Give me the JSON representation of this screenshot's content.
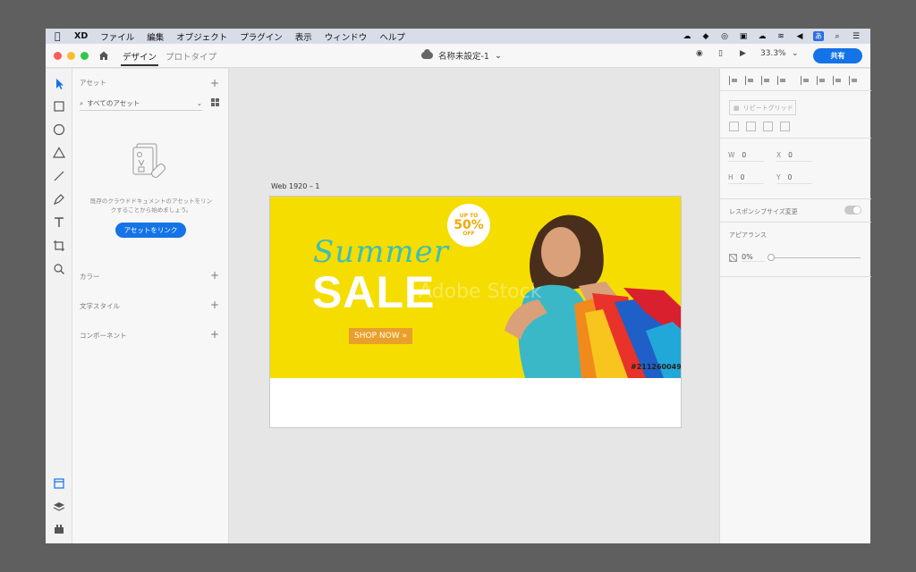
{
  "menubar": {
    "app": "XD",
    "items": [
      "ファイル",
      "編集",
      "オブジェクト",
      "プラグイン",
      "表示",
      "ウィンドウ",
      "ヘルプ"
    ],
    "ime": "あ"
  },
  "titlebar": {
    "tabs": [
      "デザイン",
      "プロトタイプ"
    ],
    "doc_title": "名称未設定-1",
    "zoom": "33.3%",
    "share": "共有"
  },
  "assets": {
    "title": "アセット",
    "filter": "すべてのアセット",
    "empty_text": "既存のクラウドドキュメントのアセットをリンクすることから始めましょう。",
    "link_button": "アセットをリンク",
    "sections": [
      "カラー",
      "文字スタイル",
      "コンポーネント"
    ]
  },
  "canvas": {
    "artboard_name": "Web 1920 – 1",
    "banner": {
      "badge_top": "UP TO",
      "badge_pct": "50%",
      "badge_bottom": "OFF",
      "summer": "Summer",
      "sale": "SALE",
      "shop_now": "SHOP NOW »",
      "watermark": "Adobe Stock",
      "stock_id": "#211260049"
    }
  },
  "properties": {
    "repeat_grid": "リピートグリッド",
    "w_label": "W",
    "w": "0",
    "h_label": "H",
    "h": "0",
    "x_label": "X",
    "x": "0",
    "y_label": "Y",
    "y": "0",
    "responsive_resize": "レスポンシブサイズ変更",
    "appearance": "アピアランス",
    "opacity": "0%"
  },
  "colors": {
    "accent": "#1473e6",
    "banner_yellow": "#f5dd00",
    "summer_teal": "#3fbfb0",
    "shop_orange": "#e9a02a"
  }
}
